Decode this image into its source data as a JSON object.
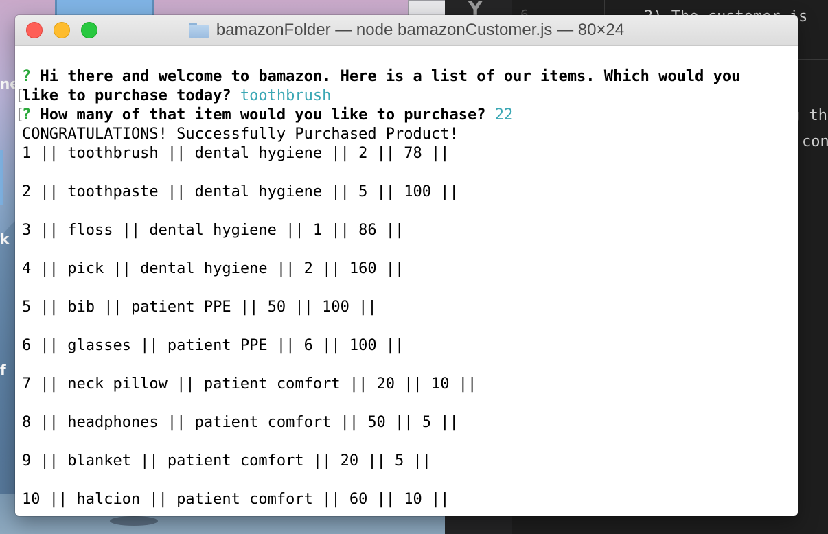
{
  "window": {
    "title": "bamazonFolder — node bamazonCustomer.js — 80×24",
    "folder_icon": "folder-icon",
    "buttons": {
      "close_icon": "close-icon",
      "minimize_icon": "minimize-icon",
      "zoom_icon": "zoom-icon"
    }
  },
  "terminal": {
    "prompt1": {
      "mark": "?",
      "question_line1": "Hi there and welcome to bamazon. Here is a list of our items. Which would you",
      "question_line2": "like to purchase today?",
      "answer": "toothbrush"
    },
    "prompt2": {
      "mark": "?",
      "question": "How many of that item would you like to purchase?",
      "answer": "22"
    },
    "success_message": "CONGRATULATIONS! Successfully Purchased Product!",
    "products": [
      "1 || toothbrush || dental hygiene || 2 || 78 ||",
      "2 || toothpaste || dental hygiene || 5 || 100 ||",
      "3 || floss || dental hygiene || 1 || 86 ||",
      "4 || pick || dental hygiene || 2 || 160 ||",
      "5 || bib || patient PPE || 50 || 100 ||",
      "6 || glasses || patient PPE || 6 || 100 ||",
      "7 || neck pillow || patient comfort || 20 || 10 ||",
      "8 || headphones || patient comfort || 50 || 5 ||",
      "9 || blanket || patient comfort || 20 || 5 ||",
      "10 || halcion || patient comfort || 60 || 10 ||"
    ]
  },
  "background": {
    "editor_line_number": "6",
    "editor_text_1": "2) The customer is",
    "editor_text_2": "g th",
    "editor_text_3": "con",
    "desktop_text_1": "ne",
    "desktop_text_2": "k",
    "desktop_text_3": "f"
  },
  "colors": {
    "prompt_mark": "#2aa83a",
    "answer": "#3aa7b4",
    "close": "#fe5f57",
    "minimize": "#febc2e",
    "zoom": "#28c840"
  }
}
